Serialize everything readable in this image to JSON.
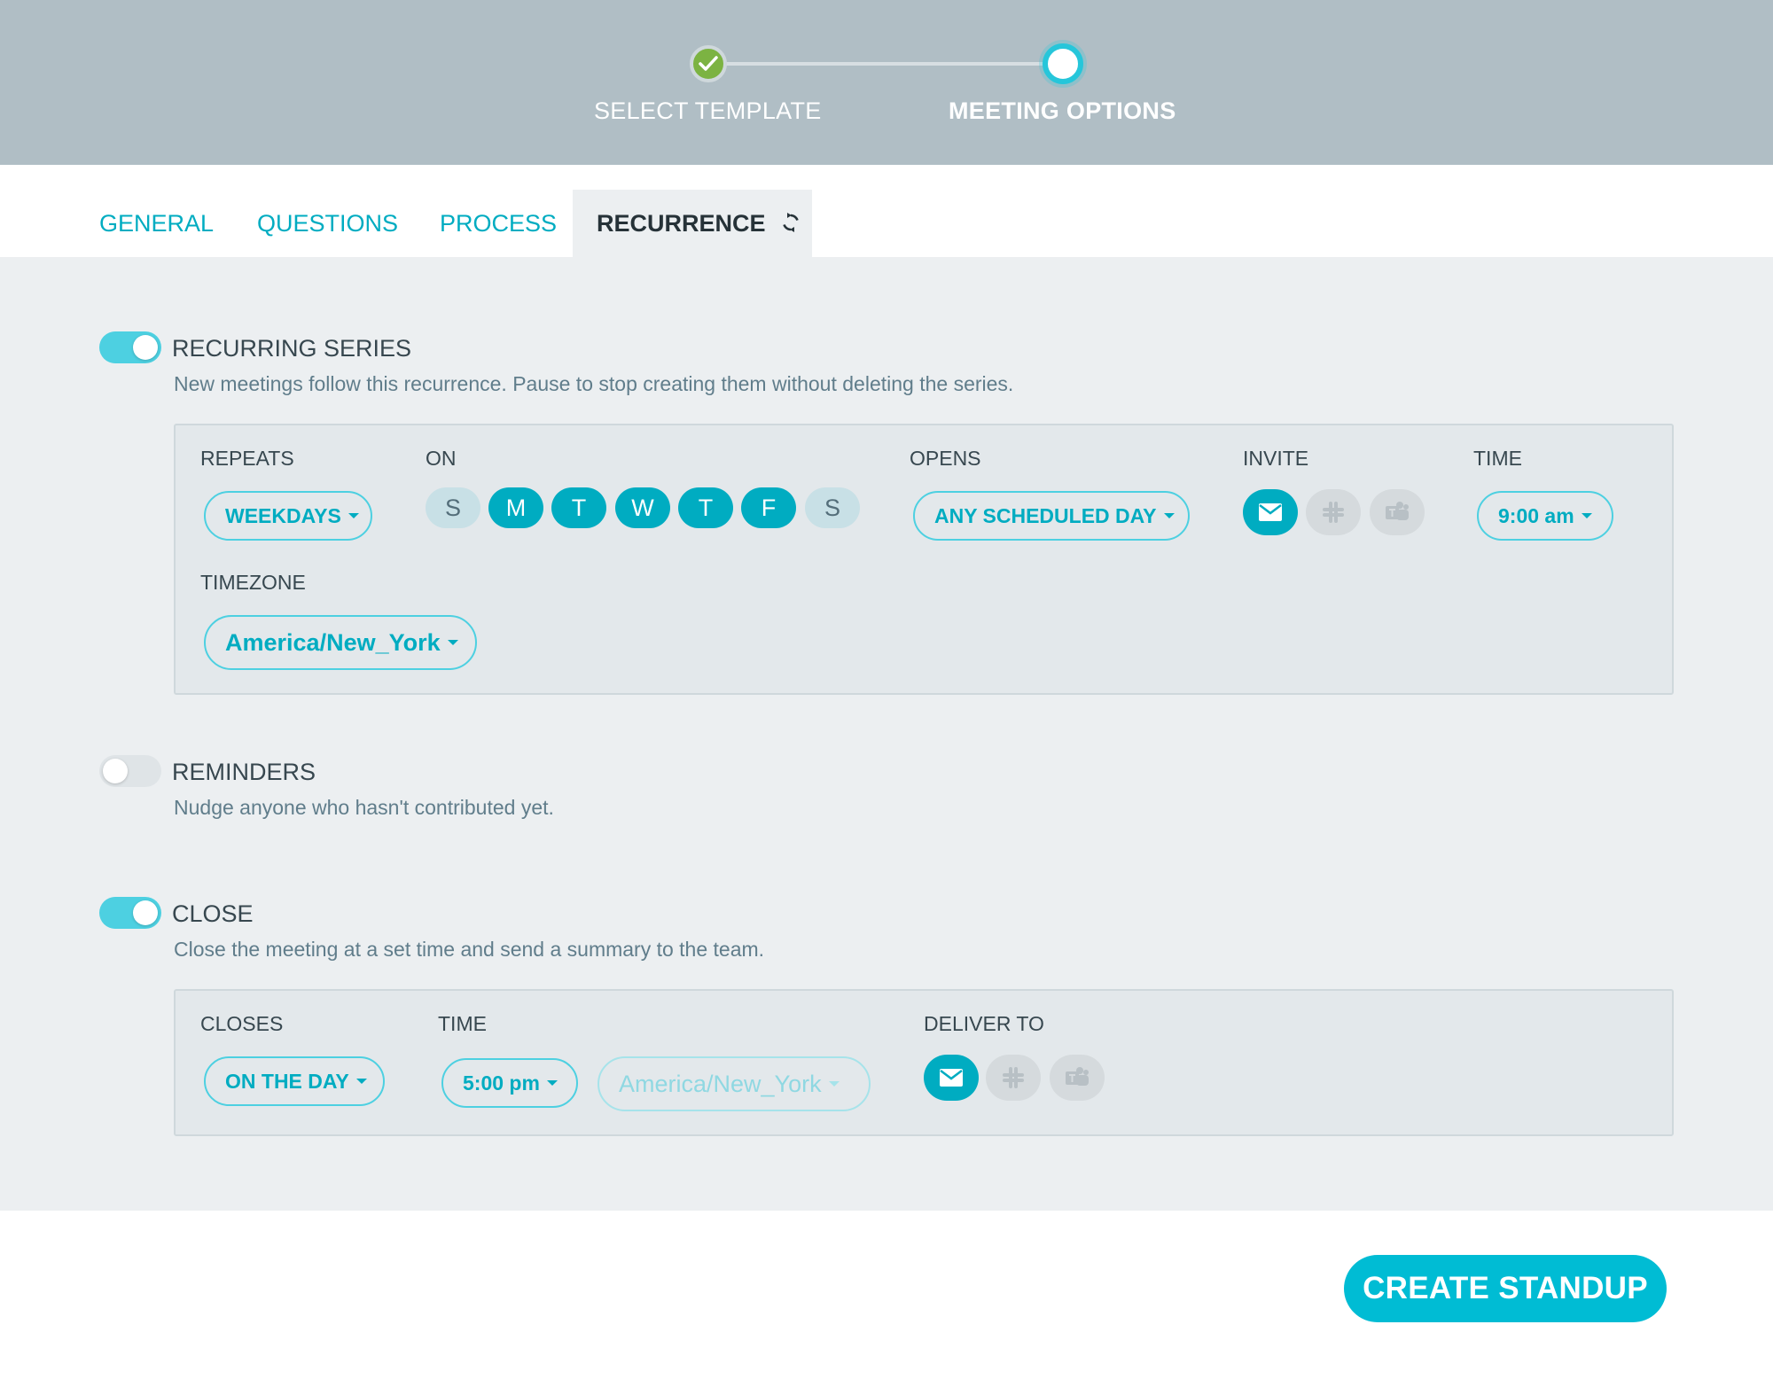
{
  "stepper": {
    "steps": [
      {
        "label": "SELECT TEMPLATE",
        "state": "done"
      },
      {
        "label": "MEETING OPTIONS",
        "state": "current"
      }
    ]
  },
  "tabs": [
    {
      "label": "GENERAL"
    },
    {
      "label": "QUESTIONS"
    },
    {
      "label": "PROCESS"
    },
    {
      "label": "RECURRENCE",
      "active": true,
      "icon": "refresh-icon"
    }
  ],
  "recurring": {
    "title": "RECURRING SERIES",
    "enabled": true,
    "description": "New meetings follow this recurrence. Pause to stop creating them without deleting the series.",
    "repeats_label": "REPEATS",
    "repeats_value": "WEEKDAYS",
    "on_label": "ON",
    "days": [
      {
        "letter": "S",
        "selected": false
      },
      {
        "letter": "M",
        "selected": true
      },
      {
        "letter": "T",
        "selected": true
      },
      {
        "letter": "W",
        "selected": true
      },
      {
        "letter": "T",
        "selected": true
      },
      {
        "letter": "F",
        "selected": true
      },
      {
        "letter": "S",
        "selected": false
      }
    ],
    "opens_label": "OPENS",
    "opens_value": "ANY SCHEDULED DAY",
    "invite_label": "INVITE",
    "invite_channels": [
      {
        "icon": "email-icon",
        "selected": true
      },
      {
        "icon": "slack-icon",
        "selected": false
      },
      {
        "icon": "teams-icon",
        "selected": false
      }
    ],
    "time_label": "TIME",
    "time_value": "9:00 am",
    "timezone_label": "TIMEZONE",
    "timezone_value": "America/New_York"
  },
  "reminders": {
    "title": "REMINDERS",
    "enabled": false,
    "description": "Nudge anyone who hasn't contributed yet."
  },
  "close": {
    "title": "CLOSE",
    "enabled": true,
    "description": "Close the meeting at a set time and send a summary to the team.",
    "closes_label": "CLOSES",
    "closes_value": "ON THE DAY",
    "time_label": "TIME",
    "time_value": "5:00 pm",
    "timezone_value": "America/New_York",
    "deliver_label": "DELIVER TO",
    "deliver_channels": [
      {
        "icon": "email-icon",
        "selected": true
      },
      {
        "icon": "slack-icon",
        "selected": false
      },
      {
        "icon": "teams-icon",
        "selected": false
      }
    ]
  },
  "footer": {
    "create_label": "CREATE STANDUP"
  },
  "colors": {
    "accent": "#00bcd4",
    "accent_dark": "#00acc1",
    "done_green": "#7cb342",
    "header_bg": "#b0bec5"
  }
}
